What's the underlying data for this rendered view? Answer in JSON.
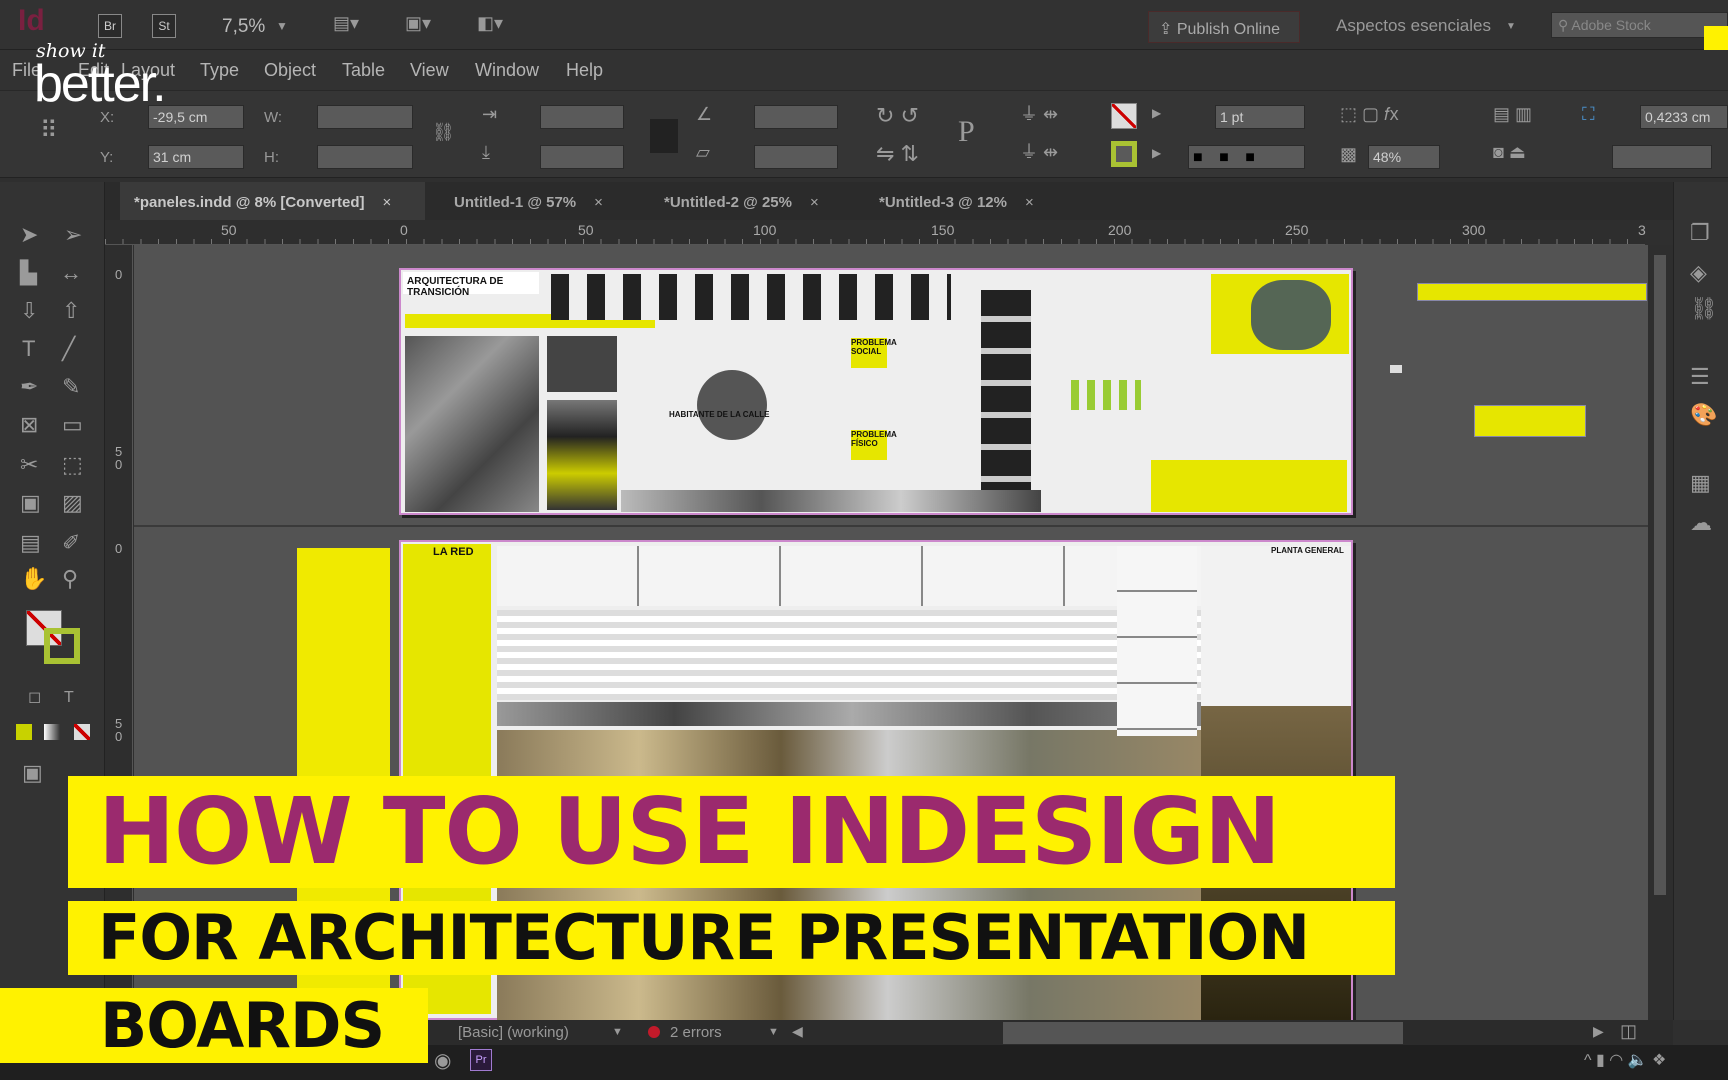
{
  "app": {
    "logo": "Id",
    "bridge": "Br",
    "stock": "St",
    "zoom": "7,5%",
    "publish": "Publish Online",
    "workspace": "Aspectos esenciales",
    "search_placeholder": "Adobe Stock"
  },
  "watermark": {
    "line1": "show it",
    "line2": "better."
  },
  "menu": [
    "File",
    "Edit",
    "Layout",
    "Type",
    "Object",
    "Table",
    "View",
    "Window",
    "Help"
  ],
  "control": {
    "x_label": "X:",
    "x_value": "-29,5 cm",
    "y_label": "Y:",
    "y_value": "31 cm",
    "w_label": "W:",
    "h_label": "H:",
    "stroke_weight": "1 pt",
    "opacity": "48%",
    "offset": "0,4233 cm"
  },
  "tabs": [
    {
      "label": "*paneles.indd @ 8% [Converted]",
      "close": "×"
    },
    {
      "label": "Untitled-1 @ 57%",
      "close": "×"
    },
    {
      "label": "*Untitled-2 @ 25%",
      "close": "×"
    },
    {
      "label": "*Untitled-3 @ 12%",
      "close": "×"
    }
  ],
  "ruler": [
    "50",
    "0",
    "50",
    "100",
    "150",
    "200",
    "250",
    "300",
    "3"
  ],
  "vruler": [
    "0",
    "5\n0",
    "0",
    "5\n0"
  ],
  "boards": {
    "page1_title": "ARQUITECTURA DE TRANSICIÓN",
    "page1_center": "HABITANTE DE LA CALLE",
    "page1_social": "PROBLEMA SOCIAL",
    "page1_fisico": "PROBLEMA FÍSICO",
    "page2_title": "LA RED",
    "page2_plan": "PLANTA GENERAL"
  },
  "overlay": {
    "line1": "HOW TO USE INDESIGN",
    "line2": "FOR ARCHITECTURE PRESENTATION",
    "line3": "BOARDS",
    "yellow": "#fff200",
    "magenta": "#9b2a6e"
  },
  "status": {
    "preflight_profile": "[Basic] (working)",
    "errors": "2 errors"
  }
}
